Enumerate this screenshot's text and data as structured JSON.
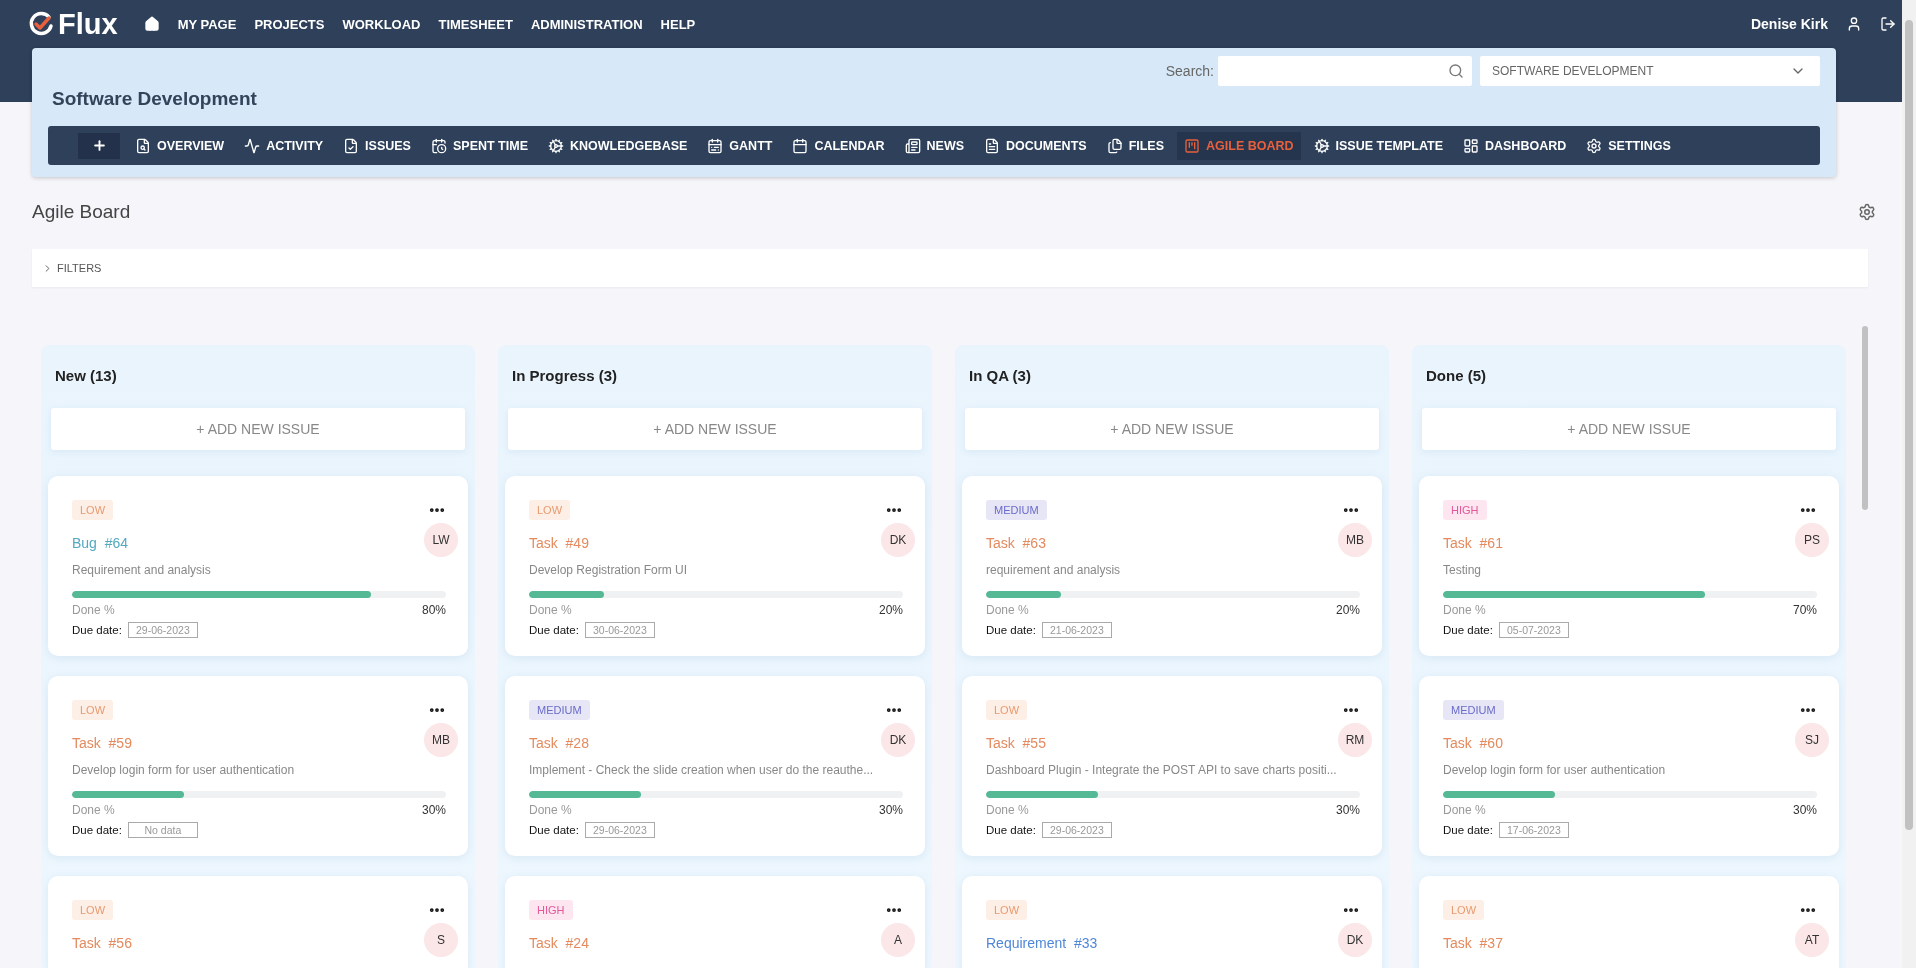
{
  "app": {
    "logo": "Flux",
    "user": "Denise Kirk"
  },
  "top_menu": [
    "MY PAGE",
    "PROJECTS",
    "WORKLOAD",
    "TIMESHEET",
    "ADMINISTRATION",
    "HELP"
  ],
  "project": {
    "title": "Software Development",
    "search_label": "Search:",
    "project_select": "SOFTWARE DEVELOPMENT"
  },
  "project_nav": [
    {
      "label": "OVERVIEW",
      "selected": false
    },
    {
      "label": "ACTIVITY",
      "selected": false
    },
    {
      "label": "ISSUES",
      "selected": false
    },
    {
      "label": "SPENT TIME",
      "selected": false
    },
    {
      "label": "KNOWLEDGEBASE",
      "selected": false
    },
    {
      "label": "GANTT",
      "selected": false
    },
    {
      "label": "CALENDAR",
      "selected": false
    },
    {
      "label": "NEWS",
      "selected": false
    },
    {
      "label": "DOCUMENTS",
      "selected": false
    },
    {
      "label": "FILES",
      "selected": false
    },
    {
      "label": "AGILE BOARD",
      "selected": true
    },
    {
      "label": "ISSUE TEMPLATE",
      "selected": false
    },
    {
      "label": "DASHBOARD",
      "selected": false
    },
    {
      "label": "SETTINGS",
      "selected": false
    }
  ],
  "page": {
    "title": "Agile Board",
    "filters": "FILTERS",
    "filters_expanded": false
  },
  "columns": [
    {
      "title": "New (13)",
      "add_label": "+ ADD NEW ISSUE",
      "cards": [
        {
          "priority": {
            "label": "LOW",
            "kind": "low"
          },
          "kind": "bug",
          "issue": "Bug  #64",
          "assignee": "LW",
          "description": "Requirement and analysis",
          "level": 0.8,
          "done_label": "Done %",
          "done": "80%",
          "due_label": "Due date:",
          "due": "29-06-2023"
        },
        {
          "priority": {
            "label": "LOW",
            "kind": "low"
          },
          "kind": "task",
          "issue": "Task  #59",
          "assignee": "MB",
          "description": "Develop login form for user authentication",
          "level": 0.3,
          "done_label": "Done %",
          "done": "30%",
          "due_label": "Due date:",
          "due": "No data"
        },
        {
          "priority": {
            "label": "LOW",
            "kind": "low"
          },
          "kind": "task",
          "issue": "Task  #56",
          "assignee": "S"
        }
      ]
    },
    {
      "title": "In Progress (3)",
      "add_label": "+ ADD NEW ISSUE",
      "cards": [
        {
          "priority": {
            "label": "LOW",
            "kind": "low"
          },
          "kind": "task",
          "issue": "Task  #49",
          "assignee": "DK",
          "description": "Develop Registration Form UI",
          "level": 0.2,
          "done_label": "Done %",
          "done": "20%",
          "due_label": "Due date:",
          "due": "30-06-2023"
        },
        {
          "priority": {
            "label": "MEDIUM",
            "kind": "medium"
          },
          "kind": "task",
          "issue": "Task  #28",
          "assignee": "DK",
          "description": "Implement - Check the slide creation when user do the reauthe...",
          "level": 0.3,
          "done_label": "Done %",
          "done": "30%",
          "due_label": "Due date:",
          "due": "29-06-2023"
        },
        {
          "priority": {
            "label": "HIGH",
            "kind": "high"
          },
          "kind": "task",
          "issue": "Task  #24",
          "assignee": "A"
        }
      ]
    },
    {
      "title": "In QA (3)",
      "add_label": "+ ADD NEW ISSUE",
      "cards": [
        {
          "priority": {
            "label": "MEDIUM",
            "kind": "medium"
          },
          "kind": "task",
          "issue": "Task  #63",
          "assignee": "MB",
          "description": "requirement and analysis",
          "level": 0.2,
          "done_label": "Done %",
          "done": "20%",
          "due_label": "Due date:",
          "due": "21-06-2023"
        },
        {
          "priority": {
            "label": "LOW",
            "kind": "low"
          },
          "kind": "task",
          "issue": "Task  #55",
          "assignee": "RM",
          "description": "Dashboard Plugin - Integrate the POST API to save charts positi...",
          "level": 0.3,
          "done_label": "Done %",
          "done": "30%",
          "due_label": "Due date:",
          "due": "29-06-2023"
        },
        {
          "priority": {
            "label": "LOW",
            "kind": "low"
          },
          "kind": "requirement",
          "issue": "Requirement  #33",
          "assignee": "DK"
        }
      ]
    },
    {
      "title": "Done (5)",
      "add_label": "+ ADD NEW ISSUE",
      "cards": [
        {
          "priority": {
            "label": "HIGH",
            "kind": "high"
          },
          "kind": "task",
          "issue": "Task  #61",
          "assignee": "PS",
          "description": "Testing",
          "level": 0.7,
          "done_label": "Done %",
          "done": "70%",
          "due_label": "Due date:",
          "due": "05-07-2023"
        },
        {
          "priority": {
            "label": "MEDIUM",
            "kind": "medium"
          },
          "kind": "task",
          "issue": "Task  #60",
          "assignee": "SJ",
          "description": "Develop login form for user authentication",
          "level": 0.3,
          "done_label": "Done %",
          "done": "30%",
          "due_label": "Due date:",
          "due": "17-06-2023"
        },
        {
          "priority": {
            "label": "LOW",
            "kind": "low"
          },
          "kind": "task",
          "issue": "Task  #37",
          "assignee": "AT"
        }
      ]
    }
  ]
}
